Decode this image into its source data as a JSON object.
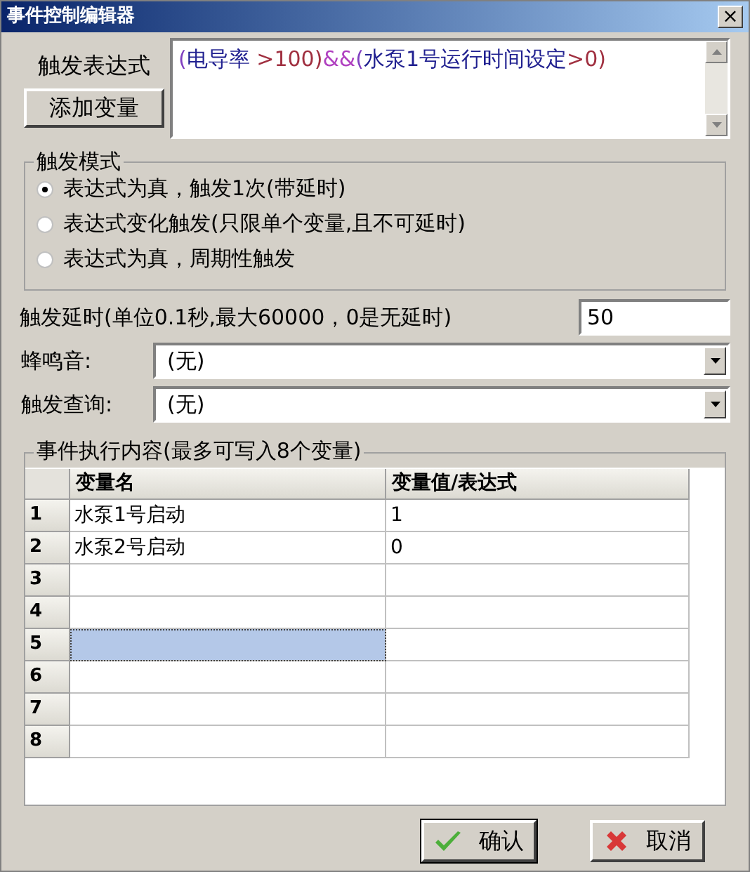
{
  "window": {
    "title": "事件控制编辑器",
    "close": "×"
  },
  "expression": {
    "label": "触发表达式",
    "add_button": "添加变量",
    "tokens": [
      {
        "text": "(",
        "color": "#8040c0"
      },
      {
        "text": "电导率 ",
        "color": "#202090"
      },
      {
        "text": ">100)",
        "color": "#a03040"
      },
      {
        "text": "&&",
        "color": "#b040c0"
      },
      {
        "text": "(",
        "color": "#8040c0"
      },
      {
        "text": "水泵1号运行时间设定",
        "color": "#202090"
      },
      {
        "text": ">0)",
        "color": "#a03040"
      }
    ]
  },
  "trigger_mode": {
    "title": "触发模式",
    "options": [
      {
        "label": "表达式为真，触发1次(带延时)",
        "selected": true
      },
      {
        "label": "表达式变化触发(只限单个变量,且不可延时)",
        "selected": false
      },
      {
        "label": "表达式为真，周期性触发",
        "selected": false
      }
    ]
  },
  "delay": {
    "label": "触发延时(单位0.1秒,最大60000，0是无延时)",
    "value": "50"
  },
  "buzzer": {
    "label": "蜂鸣音:",
    "value": "(无)"
  },
  "query": {
    "label": "触发查询:",
    "value": "(无)"
  },
  "actions": {
    "title": "事件执行内容(最多可写入8个变量)",
    "columns": [
      "变量名",
      "变量值/表达式"
    ],
    "rows": [
      {
        "index": "1",
        "name": "水泵1号启动",
        "value": "1",
        "selected": false
      },
      {
        "index": "2",
        "name": "水泵2号启动",
        "value": "0",
        "selected": false
      },
      {
        "index": "3",
        "selected": false
      },
      {
        "index": "4",
        "selected": false
      },
      {
        "index": "5",
        "selected": true
      },
      {
        "index": "6",
        "selected": false
      },
      {
        "index": "7",
        "selected": false
      },
      {
        "index": "8",
        "selected": false
      }
    ]
  },
  "buttons": [
    {
      "kind": "ok",
      "label": "确认"
    },
    {
      "kind": "cancel",
      "label": "取消"
    }
  ]
}
